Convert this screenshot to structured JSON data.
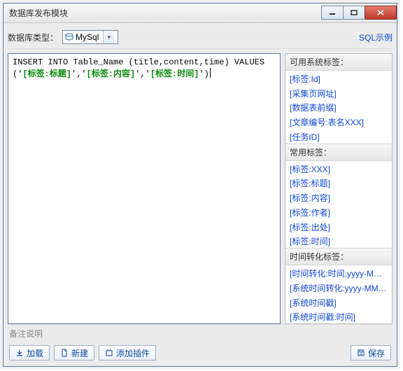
{
  "window": {
    "title": "数据库发布模块"
  },
  "toprow": {
    "label": "数据库类型：",
    "db_type": "MySql",
    "sql_sample": "SQL示例"
  },
  "editor": {
    "parts": [
      {
        "t": "plain",
        "v": "INSERT INTO Table_Name (title,content,time) VALUES ('"
      },
      {
        "t": "tag",
        "v": "[标签:标题]"
      },
      {
        "t": "plain",
        "v": "','"
      },
      {
        "t": "tag",
        "v": "[标签:内容]"
      },
      {
        "t": "plain",
        "v": "','"
      },
      {
        "t": "tag",
        "v": "[标签:时间]"
      },
      {
        "t": "plain",
        "v": "')"
      }
    ]
  },
  "tags": {
    "groups": [
      {
        "header": "可用系统标签：",
        "items": [
          "[标签:Id]",
          "[采集页网址]",
          "[数据表前缀]",
          "[文章编号:表名XXX]",
          "[任务ID]"
        ]
      },
      {
        "header": "常用标签：",
        "items": [
          "[标签:XXX]",
          "[标签:标题]",
          "[标签:内容]",
          "[标签:作者]",
          "[标签:出处]",
          "[标签:时间]"
        ]
      },
      {
        "header": "时间转化标签：",
        "items": [
          "[时间转化:时间,yyyy-MM-dd]",
          "[系统时间转化:yyyy-MM-dd]",
          "[系统时间戳]",
          "[系统时间戳:时间]"
        ]
      }
    ]
  },
  "notes": {
    "label": "备注说明"
  },
  "buttons": {
    "load": "加载",
    "new": "新建",
    "plugin": "添加插件",
    "save": "保存"
  }
}
